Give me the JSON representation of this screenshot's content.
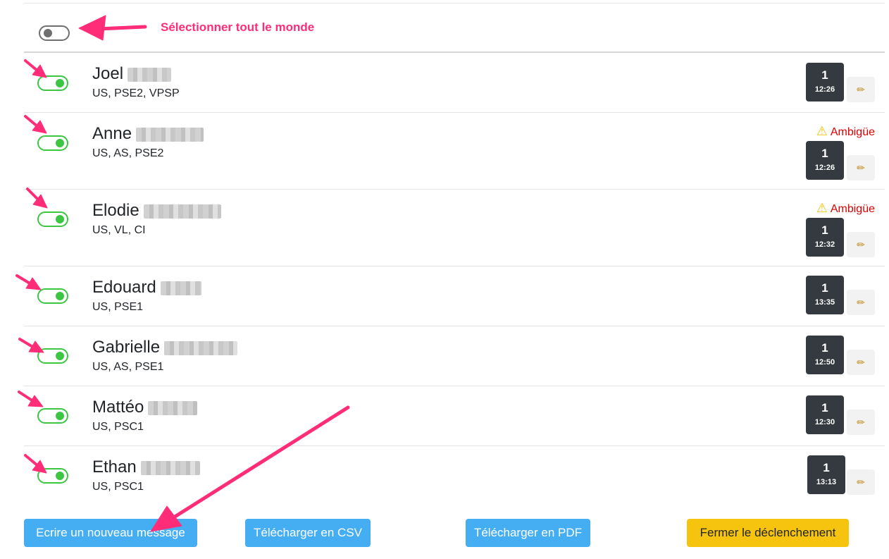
{
  "select_all": {
    "label": "Sélectionner tout le monde",
    "checked": false
  },
  "people": [
    {
      "first_name": "Joel",
      "qualifications": "US, PSE2, VPSP",
      "checked": true,
      "count": "1",
      "time": "12:26",
      "warning": ""
    },
    {
      "first_name": "Anne",
      "qualifications": "US, AS, PSE2",
      "checked": true,
      "count": "1",
      "time": "12:26",
      "warning": "Ambigüe"
    },
    {
      "first_name": "Elodie",
      "qualifications": "US, VL, CI",
      "checked": true,
      "count": "1",
      "time": "12:32",
      "warning": "Ambigüe"
    },
    {
      "first_name": "Edouard",
      "qualifications": "US, PSE1",
      "checked": true,
      "count": "1",
      "time": "13:35",
      "warning": ""
    },
    {
      "first_name": "Gabrielle",
      "qualifications": "US, AS, PSE1",
      "checked": true,
      "count": "1",
      "time": "12:50",
      "warning": ""
    },
    {
      "first_name": "Mattéo",
      "qualifications": "US, PSC1",
      "checked": true,
      "count": "1",
      "time": "12:30",
      "warning": ""
    },
    {
      "first_name": "Ethan",
      "qualifications": "US, PSC1",
      "checked": true,
      "count": "1",
      "time": "13:13",
      "warning": ""
    }
  ],
  "icons": {
    "edit": "pencil-icon",
    "warning": "warning-icon"
  },
  "actions": {
    "new_message": "Ecrire un nouveau message",
    "download_csv": "Télécharger en CSV",
    "download_pdf": "Télécharger en PDF",
    "close_trigger": "Fermer le déclenchement"
  },
  "colors": {
    "toggle_on": "#3cc644",
    "toggle_off": "#6f6f6f",
    "badge": "#343a40",
    "warning_text": "#e00000",
    "annotation": "#ff2d78",
    "primary_button": "#45aef2",
    "warning_button": "#f6c30f"
  }
}
